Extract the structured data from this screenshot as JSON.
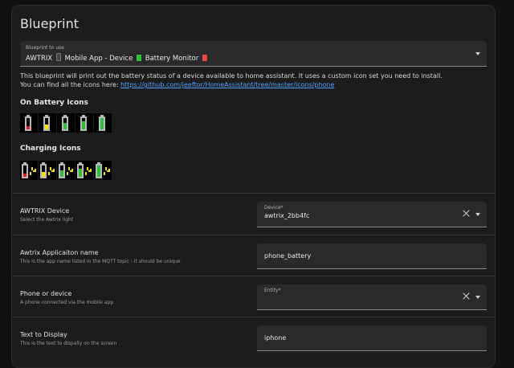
{
  "card": {
    "title": "Blueprint"
  },
  "blueprint_select": {
    "label": "Blueprint to use",
    "value_prefix": "AWTRIX",
    "value_middle": "Mobile App - Device",
    "value_suffix": "Battery Monitor"
  },
  "description": {
    "line1": "This blueprint will print out the battery status of a device available to home assistant. It uses a custom icon set you need to install.",
    "line2_prefix": "You can find all the icons here:",
    "link": "https://github.com/jeeftor/HomeAssistant/tree/master/icons/phone"
  },
  "battery_icons": {
    "title": "On Battery Icons",
    "icons": [
      "battery-low-icon",
      "battery-medium-icon",
      "battery-high-icon",
      "battery-higher-icon",
      "battery-full-icon"
    ]
  },
  "charging_icons": {
    "title": "Charging Icons",
    "icons": [
      "charging-low-icon",
      "charging-medium-icon",
      "charging-high-icon",
      "charging-higher-icon",
      "charging-full-icon"
    ]
  },
  "inputs": [
    {
      "title": "AWTRIX Device",
      "subtitle": "Select the Awtrix light",
      "field_label": "Device*",
      "field_value": "awtrix_2bb4fc",
      "clearable": true,
      "dropdown": true
    },
    {
      "title": "Awtrix Applicaiton name",
      "subtitle": "This is the app name listed in the MQTT topic - it should be unique",
      "field_label": "",
      "field_value": "phone_battery",
      "clearable": false,
      "dropdown": false
    },
    {
      "title": "Phone or device",
      "subtitle": "A phone connected via the mobile app",
      "field_label": "Entity*",
      "field_value": "",
      "clearable": true,
      "dropdown": true
    },
    {
      "title": "Text to Display",
      "subtitle": "This is the text to dispally on the screen",
      "field_label": "",
      "field_value": "iphone",
      "clearable": false,
      "dropdown": false
    }
  ],
  "colors": {
    "accent_link": "#4ea1ff",
    "battery_red": "#e02020",
    "battery_yellow": "#f2e600",
    "battery_green": "#2fbf3a",
    "battery_outline": "#b8b8b8"
  }
}
